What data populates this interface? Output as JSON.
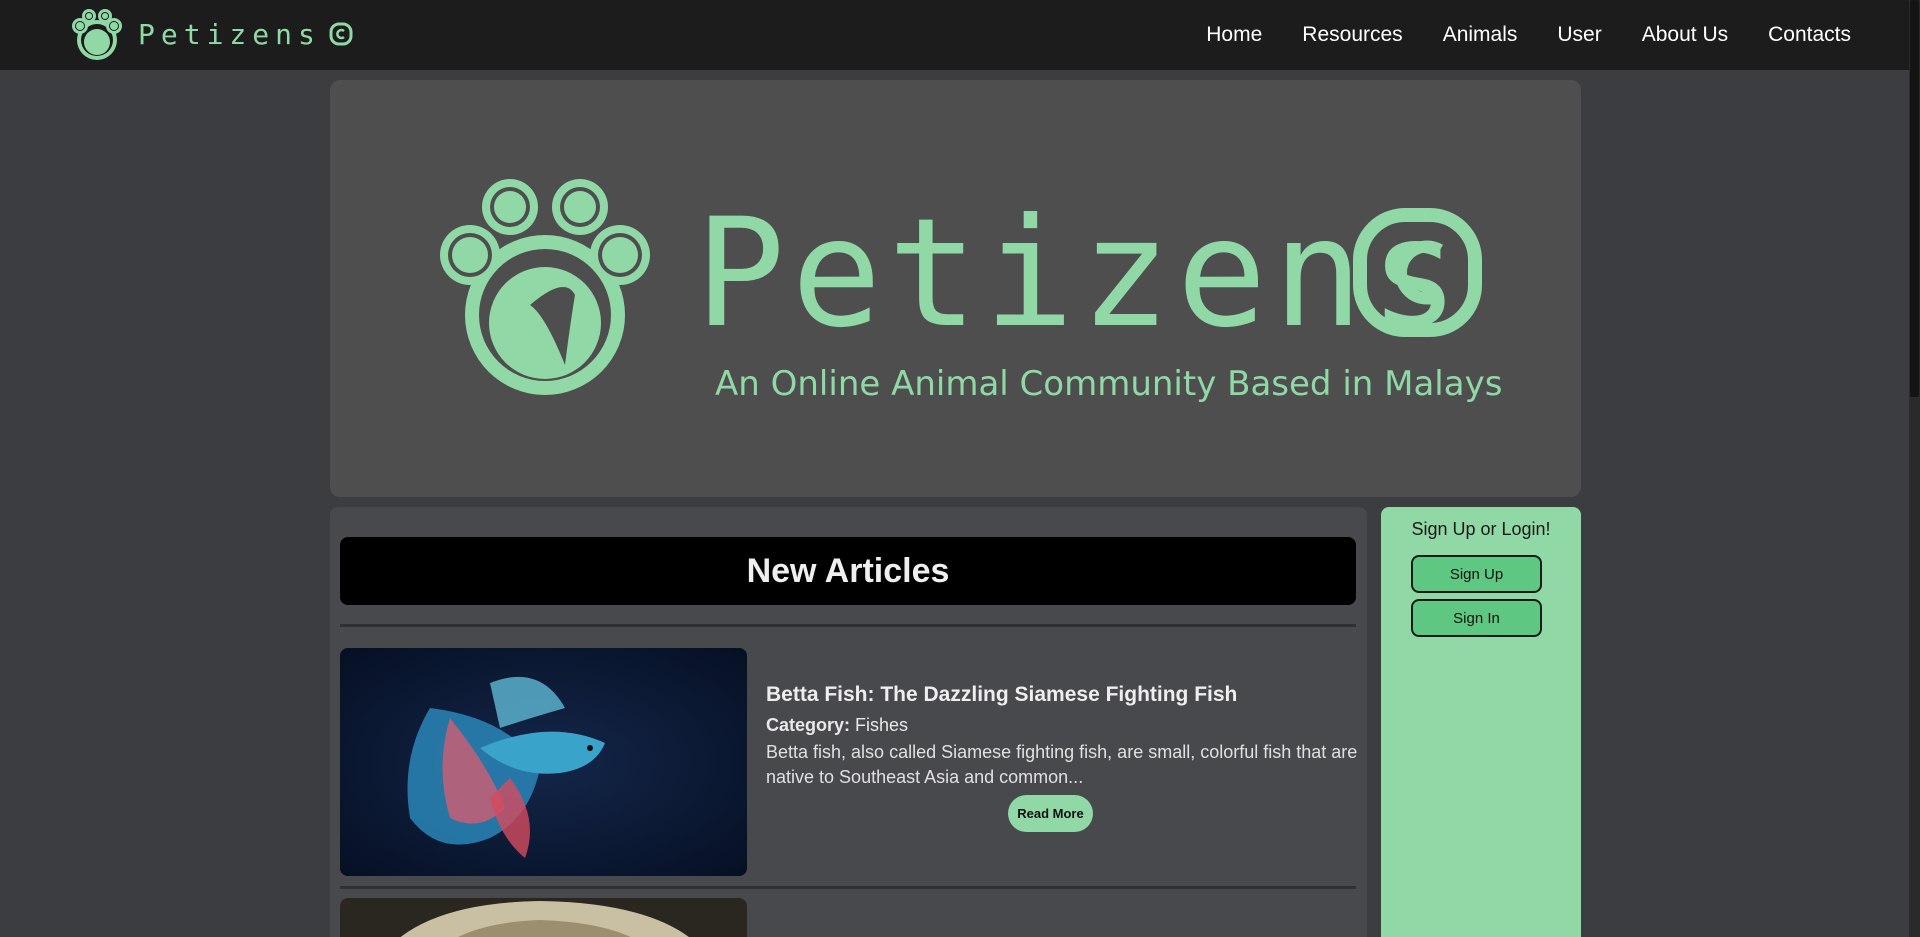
{
  "brand": {
    "name": "Petizens",
    "logo_icon": "paw-icon"
  },
  "nav": {
    "items": [
      {
        "label": "Home"
      },
      {
        "label": "Resources"
      },
      {
        "label": "Animals"
      },
      {
        "label": "User"
      },
      {
        "label": "About Us"
      },
      {
        "label": "Contacts"
      }
    ]
  },
  "hero": {
    "title": "Petizens",
    "tagline": "An Online Animal Community Based in Malaysia!"
  },
  "articles": {
    "heading": "New Articles",
    "items": [
      {
        "title": "Betta Fish: The Dazzling Siamese Fighting Fish",
        "category_label": "Category:",
        "category": "Fishes",
        "excerpt": "Betta fish, also called Siamese fighting fish, are small, colorful fish that are native to Southeast Asia and common...",
        "read_more": "Read More"
      }
    ]
  },
  "sidebar": {
    "title": "Sign Up or Login!",
    "signup_label": "Sign Up",
    "signin_label": "Sign In"
  },
  "colors": {
    "accent": "#90d9a6",
    "topbar": "#1c1c1c",
    "page_bg": "#3c3d40"
  }
}
